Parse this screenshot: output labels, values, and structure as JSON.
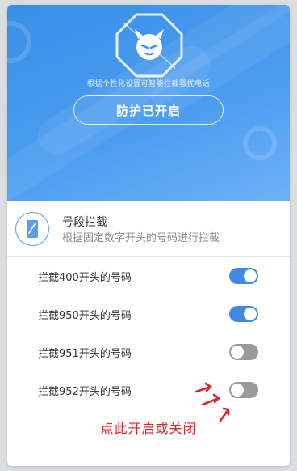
{
  "hero": {
    "subtitle": "根据个性化设置可智能拦截骚扰电话",
    "status_button": "防护已开启"
  },
  "section": {
    "icon": "phone-icon",
    "title": "号段拦截",
    "description": "根据固定数字开头的号码进行拦截"
  },
  "rows": [
    {
      "label": "拦截400开头的号码",
      "enabled": true
    },
    {
      "label": "拦截950开头的号码",
      "enabled": true
    },
    {
      "label": "拦截951开头的号码",
      "enabled": false
    },
    {
      "label": "拦截952开头的号码",
      "enabled": false
    }
  ],
  "annotation": {
    "hint": "点此开启或关闭",
    "color": "#e0202a"
  },
  "colors": {
    "accent": "#3f8ae0",
    "toggle_off": "#9a9a9a",
    "hero_top": "#3a8ee6"
  }
}
